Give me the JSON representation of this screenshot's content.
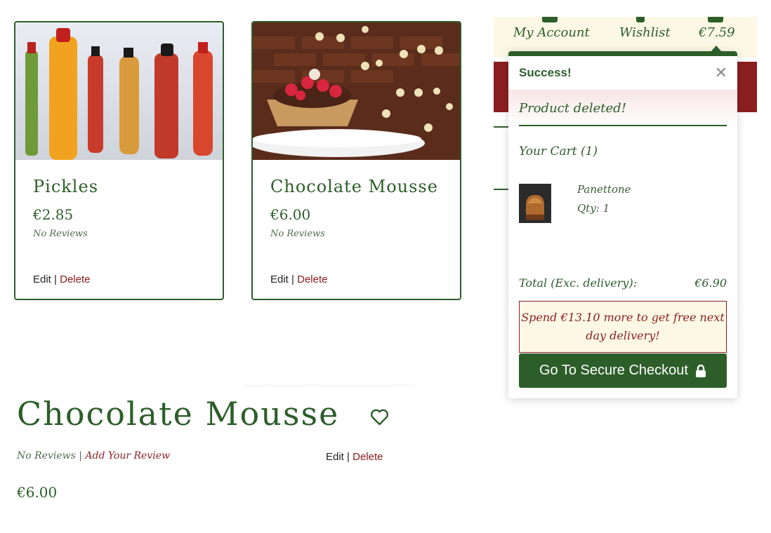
{
  "products": [
    {
      "title": "Pickles",
      "price": "€2.85",
      "reviews": "No Reviews",
      "edit": "Edit",
      "delete": "Delete",
      "separator": "|"
    },
    {
      "title": "Chocolate Mousse",
      "price": "€6.00",
      "reviews": "No Reviews",
      "edit": "Edit",
      "delete": "Delete",
      "separator": "|"
    }
  ],
  "nav": {
    "account": "My Account",
    "wishlist": "Wishlist",
    "cart_total": "€7.59"
  },
  "toast": {
    "title": "Success!",
    "close": "✕",
    "message": "Product deleted!",
    "cart_heading": "Your Cart (1)",
    "item_name": "Panettone",
    "item_qty": "Qty: 1",
    "total_label": "Total (Exc. delivery):",
    "total_value": "€6.90",
    "delivery_note": "Spend €13.10 more to get free next day delivery!",
    "checkout_label": "Go To Secure Checkout"
  },
  "detail": {
    "title": "Chocolate Mousse",
    "reviews": "No Reviews",
    "review_separator": "|",
    "add_review": "Add Your Review",
    "edit": "Edit",
    "separator": "|",
    "delete": "Delete",
    "price": "€6.00"
  },
  "colors": {
    "brand_green": "#2d5e2a",
    "brand_red": "#8b1f1f",
    "cream": "#fdf8e5"
  }
}
